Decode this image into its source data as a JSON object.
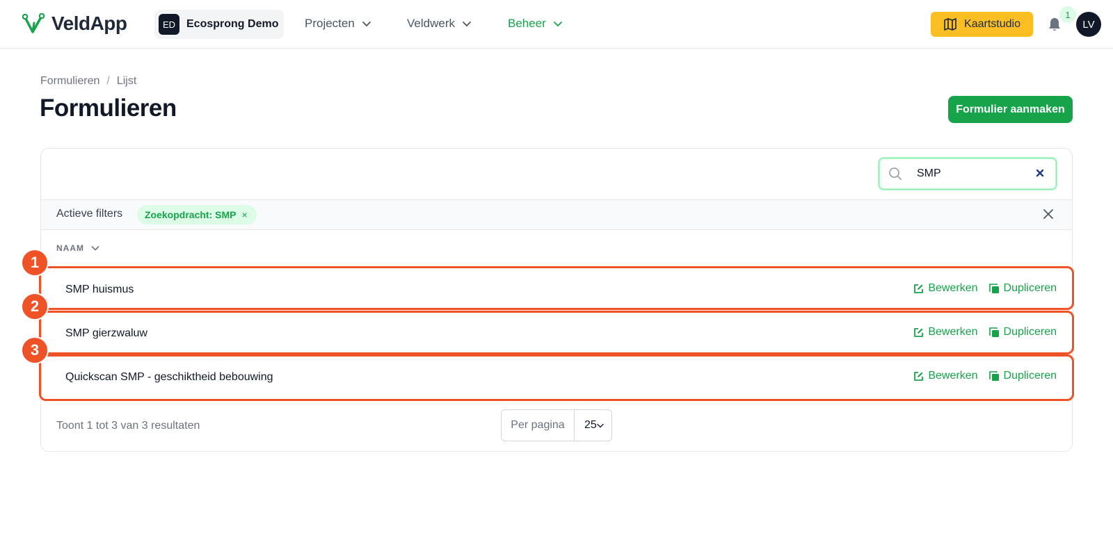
{
  "app": {
    "name": "VeldApp",
    "organization_initials": "ED",
    "organization_name": "Ecosprong Demo"
  },
  "nav": {
    "items": [
      {
        "label": "Projecten",
        "active": false
      },
      {
        "label": "Veldwerk",
        "active": false
      },
      {
        "label": "Beheer",
        "active": true
      }
    ],
    "map_studio_label": "Kaartstudio",
    "notification_count": "1",
    "user_initials": "LV"
  },
  "header": {
    "breadcrumb": [
      "Formulieren",
      "Lijst"
    ],
    "breadcrumb_separator": "/",
    "title": "Formulieren",
    "create_button_label": "Formulier aanmaken"
  },
  "search": {
    "value": "SMP"
  },
  "filters": {
    "label": "Actieve filters",
    "chips": [
      {
        "label": "Zoekopdracht: SMP",
        "remove": "×"
      }
    ]
  },
  "table": {
    "column_header": "NAAM",
    "rows": [
      {
        "name": "SMP huismus",
        "edit_label": "Bewerken",
        "duplicate_label": "Dupliceren",
        "marker": "1"
      },
      {
        "name": "SMP gierzwaluw",
        "edit_label": "Bewerken",
        "duplicate_label": "Dupliceren",
        "marker": "2"
      },
      {
        "name": "Quickscan SMP - geschiktheid bebouwing",
        "edit_label": "Bewerken",
        "duplicate_label": "Dupliceren",
        "marker": "3"
      }
    ]
  },
  "pagination": {
    "summary": "Toont 1 tot 3 van 3 resultaten",
    "per_page_label": "Per pagina",
    "per_page_value": "25"
  },
  "colors": {
    "brand_green": "#16a34a",
    "accent_yellow": "#fbbf24",
    "highlight_orange": "#ef5226"
  }
}
